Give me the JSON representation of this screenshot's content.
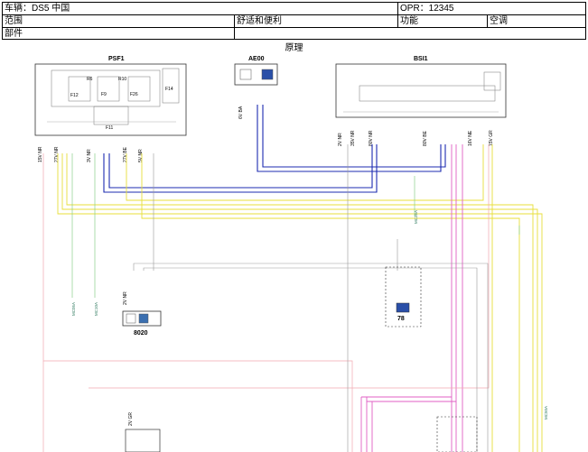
{
  "header": {
    "vehicle": "车辆：DS5 中国",
    "opr": "OPR：12345",
    "scope_label": "范围",
    "scope_value": "舒适和便利",
    "function_label": "功能",
    "function_value": "空调",
    "part_label": "部件"
  },
  "diagram": {
    "title": "原理",
    "modules": {
      "psf1": "PSF1",
      "ae00": "AE00",
      "bsi1": "BSI1",
      "m8020": "8020",
      "m78": "78"
    },
    "fuses": [
      "F12",
      "F9",
      "F26",
      "F14",
      "F11"
    ],
    "relays": [
      "R6",
      "R10"
    ],
    "connectors": {
      "psf1_a": "15V NR",
      "psf1_b": "27V NR",
      "psf1_c": "3V NR",
      "psf1_d": "27V BE",
      "psf1_e": "5V NR",
      "ae00_a": "6V BA",
      "bsi1_a": "2V NR",
      "bsi1_b": "35V NR",
      "bsi1_c": "80V NR",
      "bsi1_d": "80V BE",
      "bsi1_e": "16V NE",
      "bsi1_f": "15V GR",
      "m8020_a": "2V NR",
      "bottom_a": "2V GR"
    },
    "grounds": [
      "MC05A",
      "MC10A",
      "MC35A",
      "MC50A"
    ]
  }
}
